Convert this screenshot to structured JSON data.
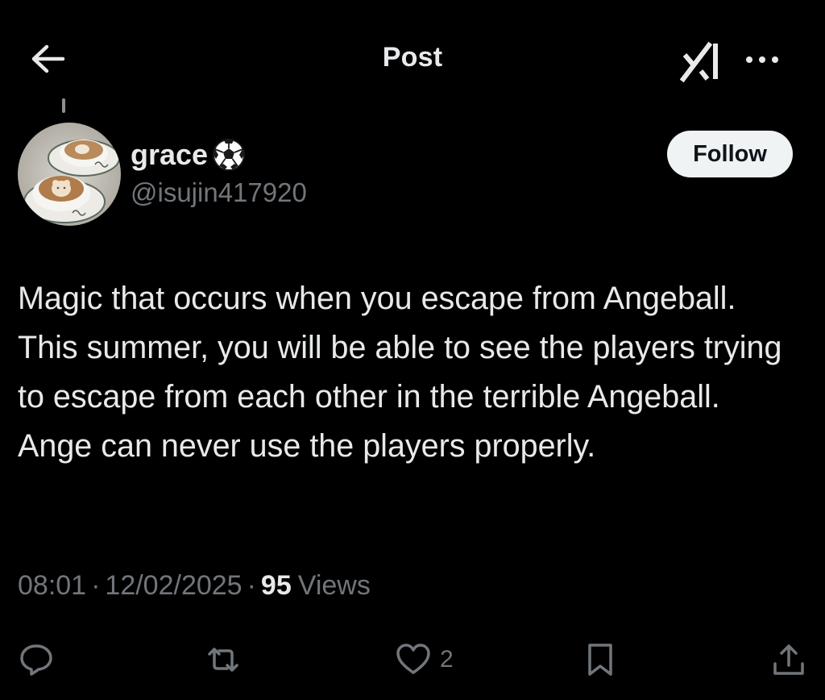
{
  "header": {
    "title": "Post",
    "back_icon": "arrow-left-icon",
    "grok_icon": "grok-logo-icon",
    "more_icon": "more-dots-icon"
  },
  "author": {
    "display_name": "grace",
    "name_emoji": "soccer-ball-icon",
    "handle": "@isujin417920",
    "follow_label": "Follow"
  },
  "post": {
    "text": "Magic that occurs when you escape from Angeball. This summer, you will be able to see the players trying to escape from each other in the terrible Angeball. Ange can never use the players properly."
  },
  "meta": {
    "time": "08:01",
    "date": "12/02/2025",
    "separator": "·",
    "views_count": "95",
    "views_label": "Views"
  },
  "actions": {
    "reply_icon": "reply-icon",
    "repost_icon": "repost-icon",
    "like_icon": "heart-icon",
    "like_count": "2",
    "bookmark_icon": "bookmark-icon",
    "share_icon": "share-icon"
  },
  "colors": {
    "background": "#000000",
    "primary_text": "#e7e9ea",
    "secondary_text": "#71767b",
    "follow_bg": "#eff3f4",
    "follow_text": "#0f1419"
  }
}
